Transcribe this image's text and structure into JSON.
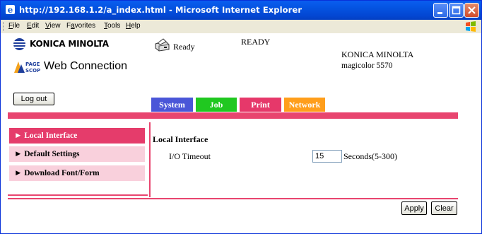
{
  "window": {
    "title": "http://192.168.1.2/a_index.html - Microsoft Internet Explorer"
  },
  "menubar": {
    "items": [
      {
        "pre": "",
        "ul": "F",
        "post": "ile"
      },
      {
        "pre": "",
        "ul": "E",
        "post": "dit"
      },
      {
        "pre": "",
        "ul": "V",
        "post": "iew"
      },
      {
        "pre": "F",
        "ul": "a",
        "post": "vorites"
      },
      {
        "pre": "",
        "ul": "T",
        "post": "ools"
      },
      {
        "pre": "",
        "ul": "H",
        "post": "elp"
      }
    ]
  },
  "header": {
    "brand": "KONICA MINOLTA",
    "web_connection": "Web Connection",
    "status_ready": "Ready",
    "panel_status": "READY",
    "manufacturer": "KONICA MINOLTA",
    "model": "magicolor 5570",
    "logout_label": "Log out"
  },
  "tabs": {
    "system": "System",
    "job": "Job",
    "print": "Print",
    "network": "Network",
    "colors": {
      "system": "#4a56d8",
      "job": "#20c820",
      "print": "#e6386a",
      "network": "#ff9e1b"
    }
  },
  "sidebar": {
    "items": [
      {
        "label": "► Local Interface",
        "active": true
      },
      {
        "label": "► Default Settings",
        "active": false
      },
      {
        "label": "► Download Font/Form",
        "active": false
      }
    ]
  },
  "main": {
    "heading": "Local Interface",
    "io_timeout_label": "I/O Timeout",
    "io_timeout_value": "15",
    "io_timeout_unit": "Seconds(5-300)"
  },
  "actions": {
    "apply": "Apply",
    "clear": "Clear"
  },
  "accent_color": "#e8456f"
}
